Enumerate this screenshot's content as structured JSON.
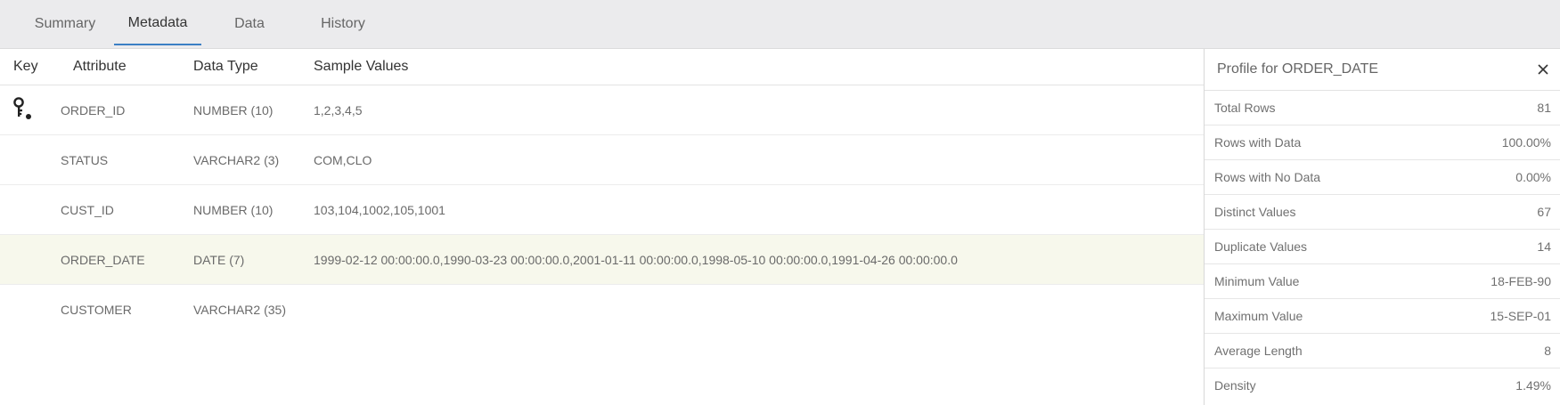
{
  "tabs": [
    "Summary",
    "Metadata",
    "Data",
    "History"
  ],
  "active_tab": "Metadata",
  "table": {
    "headers": {
      "key": "Key",
      "attribute": "Attribute",
      "data_type": "Data Type",
      "sample_values": "Sample Values"
    },
    "rows": [
      {
        "attribute": "ORDER_ID",
        "data_type": "NUMBER (10)",
        "sample_values": "1,2,3,4,5",
        "is_key": true
      },
      {
        "attribute": "STATUS",
        "data_type": "VARCHAR2 (3)",
        "sample_values": "COM,CLO"
      },
      {
        "attribute": "CUST_ID",
        "data_type": "NUMBER (10)",
        "sample_values": "103,104,1002,105,1001"
      },
      {
        "attribute": "ORDER_DATE",
        "data_type": "DATE (7)",
        "sample_values": "1999-02-12 00:00:00.0,1990-03-23 00:00:00.0,2001-01-11 00:00:00.0,1998-05-10 00:00:00.0,1991-04-26 00:00:00.0",
        "selected": true
      },
      {
        "attribute": "CUSTOMER",
        "data_type": "VARCHAR2 (35)",
        "sample_values": ""
      }
    ]
  },
  "profile": {
    "title": "Profile for ORDER_DATE",
    "rows": [
      {
        "label": "Total Rows",
        "value": "81"
      },
      {
        "label": "Rows with Data",
        "value": "100.00%"
      },
      {
        "label": "Rows with No Data",
        "value": "0.00%"
      },
      {
        "label": "Distinct Values",
        "value": "67"
      },
      {
        "label": "Duplicate Values",
        "value": "14"
      },
      {
        "label": "Minimum Value",
        "value": "18-FEB-90"
      },
      {
        "label": "Maximum Value",
        "value": "15-SEP-01"
      },
      {
        "label": "Average Length",
        "value": "8"
      },
      {
        "label": "Density",
        "value": "1.49%"
      }
    ]
  },
  "icons": {
    "key": "key-icon",
    "close": "close-icon"
  },
  "colors": {
    "tab_bar": "#ebebed",
    "active_tab_underline": "#3b7fc4",
    "selected_row": "#f7f8ec"
  }
}
